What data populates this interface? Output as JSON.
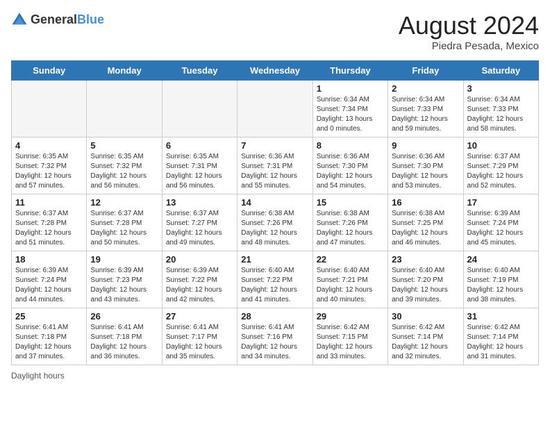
{
  "header": {
    "logo_general": "General",
    "logo_blue": "Blue",
    "month_year": "August 2024",
    "location": "Piedra Pesada, Mexico"
  },
  "days_of_week": [
    "Sunday",
    "Monday",
    "Tuesday",
    "Wednesday",
    "Thursday",
    "Friday",
    "Saturday"
  ],
  "weeks": [
    [
      {
        "day": "",
        "empty": true
      },
      {
        "day": "",
        "empty": true
      },
      {
        "day": "",
        "empty": true
      },
      {
        "day": "",
        "empty": true
      },
      {
        "day": "1",
        "sunrise": "6:34 AM",
        "sunset": "7:34 PM",
        "daylight": "13 hours and 0 minutes."
      },
      {
        "day": "2",
        "sunrise": "6:34 AM",
        "sunset": "7:33 PM",
        "daylight": "12 hours and 59 minutes."
      },
      {
        "day": "3",
        "sunrise": "6:34 AM",
        "sunset": "7:33 PM",
        "daylight": "12 hours and 58 minutes."
      }
    ],
    [
      {
        "day": "4",
        "sunrise": "6:35 AM",
        "sunset": "7:32 PM",
        "daylight": "12 hours and 57 minutes."
      },
      {
        "day": "5",
        "sunrise": "6:35 AM",
        "sunset": "7:32 PM",
        "daylight": "12 hours and 56 minutes."
      },
      {
        "day": "6",
        "sunrise": "6:35 AM",
        "sunset": "7:31 PM",
        "daylight": "12 hours and 56 minutes."
      },
      {
        "day": "7",
        "sunrise": "6:36 AM",
        "sunset": "7:31 PM",
        "daylight": "12 hours and 55 minutes."
      },
      {
        "day": "8",
        "sunrise": "6:36 AM",
        "sunset": "7:30 PM",
        "daylight": "12 hours and 54 minutes."
      },
      {
        "day": "9",
        "sunrise": "6:36 AM",
        "sunset": "7:30 PM",
        "daylight": "12 hours and 53 minutes."
      },
      {
        "day": "10",
        "sunrise": "6:37 AM",
        "sunset": "7:29 PM",
        "daylight": "12 hours and 52 minutes."
      }
    ],
    [
      {
        "day": "11",
        "sunrise": "6:37 AM",
        "sunset": "7:28 PM",
        "daylight": "12 hours and 51 minutes."
      },
      {
        "day": "12",
        "sunrise": "6:37 AM",
        "sunset": "7:28 PM",
        "daylight": "12 hours and 50 minutes."
      },
      {
        "day": "13",
        "sunrise": "6:37 AM",
        "sunset": "7:27 PM",
        "daylight": "12 hours and 49 minutes."
      },
      {
        "day": "14",
        "sunrise": "6:38 AM",
        "sunset": "7:26 PM",
        "daylight": "12 hours and 48 minutes."
      },
      {
        "day": "15",
        "sunrise": "6:38 AM",
        "sunset": "7:26 PM",
        "daylight": "12 hours and 47 minutes."
      },
      {
        "day": "16",
        "sunrise": "6:38 AM",
        "sunset": "7:25 PM",
        "daylight": "12 hours and 46 minutes."
      },
      {
        "day": "17",
        "sunrise": "6:39 AM",
        "sunset": "7:24 PM",
        "daylight": "12 hours and 45 minutes."
      }
    ],
    [
      {
        "day": "18",
        "sunrise": "6:39 AM",
        "sunset": "7:24 PM",
        "daylight": "12 hours and 44 minutes."
      },
      {
        "day": "19",
        "sunrise": "6:39 AM",
        "sunset": "7:23 PM",
        "daylight": "12 hours and 43 minutes."
      },
      {
        "day": "20",
        "sunrise": "6:39 AM",
        "sunset": "7:22 PM",
        "daylight": "12 hours and 42 minutes."
      },
      {
        "day": "21",
        "sunrise": "6:40 AM",
        "sunset": "7:22 PM",
        "daylight": "12 hours and 41 minutes."
      },
      {
        "day": "22",
        "sunrise": "6:40 AM",
        "sunset": "7:21 PM",
        "daylight": "12 hours and 40 minutes."
      },
      {
        "day": "23",
        "sunrise": "6:40 AM",
        "sunset": "7:20 PM",
        "daylight": "12 hours and 39 minutes."
      },
      {
        "day": "24",
        "sunrise": "6:40 AM",
        "sunset": "7:19 PM",
        "daylight": "12 hours and 38 minutes."
      }
    ],
    [
      {
        "day": "25",
        "sunrise": "6:41 AM",
        "sunset": "7:18 PM",
        "daylight": "12 hours and 37 minutes."
      },
      {
        "day": "26",
        "sunrise": "6:41 AM",
        "sunset": "7:18 PM",
        "daylight": "12 hours and 36 minutes."
      },
      {
        "day": "27",
        "sunrise": "6:41 AM",
        "sunset": "7:17 PM",
        "daylight": "12 hours and 35 minutes."
      },
      {
        "day": "28",
        "sunrise": "6:41 AM",
        "sunset": "7:16 PM",
        "daylight": "12 hours and 34 minutes."
      },
      {
        "day": "29",
        "sunrise": "6:42 AM",
        "sunset": "7:15 PM",
        "daylight": "12 hours and 33 minutes."
      },
      {
        "day": "30",
        "sunrise": "6:42 AM",
        "sunset": "7:14 PM",
        "daylight": "12 hours and 32 minutes."
      },
      {
        "day": "31",
        "sunrise": "6:42 AM",
        "sunset": "7:14 PM",
        "daylight": "12 hours and 31 minutes."
      }
    ]
  ],
  "footer": {
    "daylight_label": "Daylight hours"
  }
}
